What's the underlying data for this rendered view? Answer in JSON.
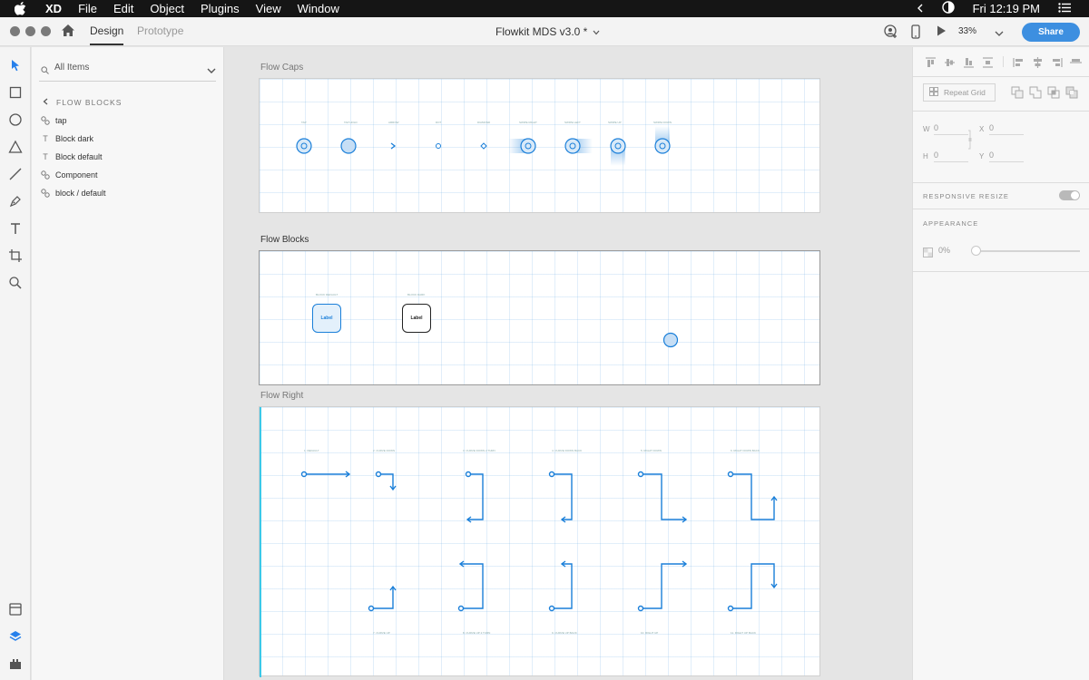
{
  "menubar": {
    "app_name": "XD",
    "menus": [
      "File",
      "Edit",
      "Object",
      "Plugins",
      "View",
      "Window"
    ],
    "clock": "Fri 12:19 PM"
  },
  "titlebar": {
    "tab_design": "Design",
    "tab_prototype": "Prototype",
    "document_title": "Flowkit MDS v3.0 *",
    "zoom": "33%",
    "share_label": "Share"
  },
  "layers": {
    "filter_label": "All Items",
    "breadcrumb": "FLOW BLOCKS",
    "items": [
      {
        "label": "tap",
        "icon": "component-icon"
      },
      {
        "label": "Block dark",
        "icon": "text-icon"
      },
      {
        "label": "Block default",
        "icon": "text-icon"
      },
      {
        "label": "Component",
        "icon": "component-icon"
      },
      {
        "label": "block / default",
        "icon": "component-icon"
      }
    ]
  },
  "canvas": {
    "artboards": [
      {
        "label": "Flow Caps"
      },
      {
        "label": "Flow Blocks"
      },
      {
        "label": "Flow Right"
      }
    ],
    "flow_caps_labels": [
      "TAP",
      "TAP HOLD",
      "ARROW",
      "DOT",
      "DIAMOND",
      "SWIPE RIGHT",
      "SWIPE LEFT",
      "SWIPE UP",
      "SWIPE DOWN"
    ],
    "flow_blocks_labels": [
      "BLOCK DEFAULT",
      "BLOCK DARK"
    ],
    "block_default_text": "Label",
    "block_dark_text": "Label",
    "flow_right_top_labels": [
      "1. DEFAULT",
      "2. CURVE DOWN",
      "3. CURVE DOWN 2 TURN",
      "4. CURVE DOWN BACK",
      "5. RIGHT DOWN",
      "6. RIGHT DOWN BACK"
    ],
    "flow_right_bottom_labels": [
      "7. CURVE UP",
      "8. CURVE UP 2 TURN",
      "9. CURVE UP BACK",
      "10. RIGHT UP",
      "11. RIGHT UP BACK"
    ]
  },
  "inspector": {
    "repeat_grid": "Repeat Grid",
    "w_label": "W",
    "w_value": "0",
    "h_label": "H",
    "h_value": "0",
    "x_label": "X",
    "x_value": "0",
    "y_label": "Y",
    "y_value": "0",
    "responsive_resize": "RESPONSIVE RESIZE",
    "appearance": "APPEARANCE",
    "opacity": "0%"
  },
  "colors": {
    "accent": "#3d8fe0",
    "flow_blue": "#1a7fd9",
    "menubar": "#151515"
  }
}
